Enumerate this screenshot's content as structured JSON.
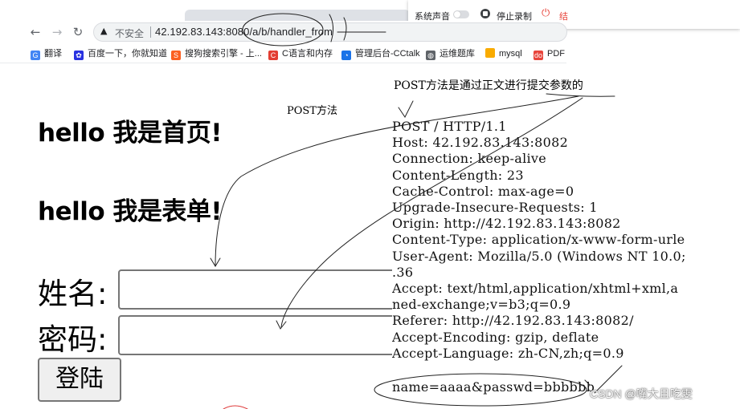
{
  "browser": {
    "back_icon": "←",
    "forward_icon": "→",
    "reload_icon": "↻",
    "warning_icon": "▲",
    "insecure_label": "不安全",
    "url": "42.192.83.143:8080/a/b/handler_from"
  },
  "bookmarks": [
    {
      "label": "翻译",
      "icon": "translate-icon",
      "color": "#4285f4",
      "glyph": "G"
    },
    {
      "label": "百度一下，你就知道",
      "icon": "baidu-icon",
      "color": "#2932e1",
      "glyph": "✿"
    },
    {
      "label": "搜狗搜索引擎 - 上...",
      "icon": "sogou-icon",
      "color": "#fb6022",
      "glyph": "S"
    },
    {
      "label": "C语言和内存",
      "icon": "csdn-icon",
      "color": "#e33e33",
      "glyph": "C"
    },
    {
      "label": "管理后台-CCtalk",
      "icon": "cctalk-icon",
      "color": "#1a73e8",
      "glyph": "◔"
    },
    {
      "label": "运维题库",
      "icon": "globe-icon",
      "color": "#5f6368",
      "glyph": "◍"
    },
    {
      "label": "mysql",
      "icon": "folder-icon",
      "color": "#f9ab00",
      "glyph": ""
    },
    {
      "label": "PDF",
      "icon": "pdf-icon",
      "color": "#e8453c",
      "glyph": "do"
    }
  ],
  "recorder": {
    "system_sound_label": "系统声音",
    "stop_recording_label": "停止录制",
    "power_icon": "⏻",
    "extra_label": "结"
  },
  "page": {
    "home_heading": "hello 我是首页!",
    "form_heading": "hello 我是表单!",
    "name_label": "姓名:",
    "password_label": "密码:",
    "login_button": "登陆"
  },
  "annotations": {
    "post_params_note": "POST方法是通过正文进行提交参数的",
    "post_method_note": "POST方法"
  },
  "http_request": {
    "lines": [
      "POST / HTTP/1.1",
      "Host: 42.192.83.143:8082",
      "Connection: keep-alive",
      "Content-Length: 23",
      "Cache-Control: max-age=0",
      "Upgrade-Insecure-Requests: 1",
      "Origin: http://42.192.83.143:8082",
      "Content-Type: application/x-www-form-urle",
      "User-Agent: Mozilla/5.0 (Windows NT 10.0;",
      ".36",
      "Accept: text/html,application/xhtml+xml,a",
      "ned-exchange;v=b3;q=0.9",
      "Referer: http://42.192.83.143:8082/",
      "Accept-Encoding: gzip, deflate",
      "Accept-Language: zh-CN,zh;q=0.9"
    ],
    "body": "name=aaaa&passwd=bbbbbb"
  },
  "watermark": "CSDN @嘴大且吃雯"
}
